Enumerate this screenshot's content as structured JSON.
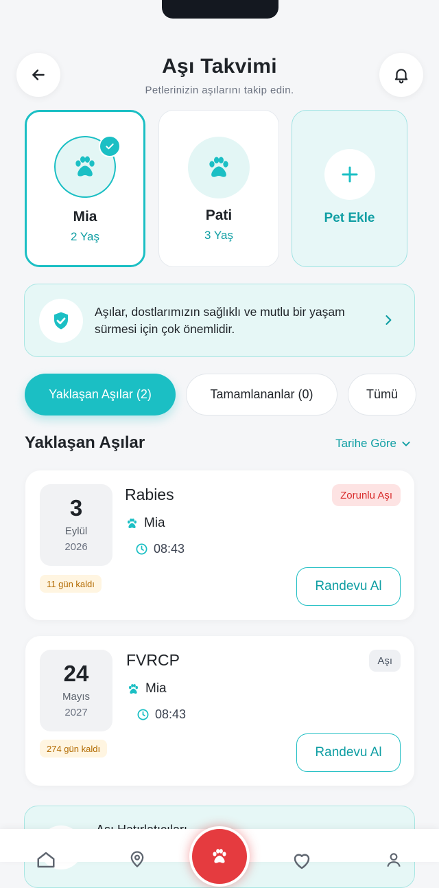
{
  "header": {
    "title": "Aşı Takvimi",
    "subtitle": "Petlerinizin aşılarını takip edin."
  },
  "pets": [
    {
      "name": "Mia",
      "age": "2 Yaş",
      "selected": true
    },
    {
      "name": "Pati",
      "age": "3 Yaş",
      "selected": false
    }
  ],
  "add_pet": {
    "label": "Pet Ekle"
  },
  "info_banner": {
    "text": "Aşılar, dostlarımızın sağlıklı ve mutlu bir yaşam sürmesi için çok önemlidir."
  },
  "tabs": [
    {
      "label": "Yaklaşan Aşılar (2)",
      "active": true
    },
    {
      "label": "Tamamlananlar (0)",
      "active": false
    },
    {
      "label": "Tümü",
      "active": false
    }
  ],
  "section": {
    "title": "Yaklaşan Aşılar",
    "sort_label": "Tarihe Göre"
  },
  "vaccines": [
    {
      "day": "3",
      "month": "Eylül",
      "year": "2026",
      "days_left": "11 gün kaldı",
      "name": "Rabies",
      "pet": "Mia",
      "time": "08:43",
      "badge": "Zorunlu Aşı",
      "badge_type": "required",
      "button": "Randevu Al"
    },
    {
      "day": "24",
      "month": "Mayıs",
      "year": "2027",
      "days_left": "274 gün kaldı",
      "name": "FVRCP",
      "pet": "Mia",
      "time": "08:43",
      "badge": "Aşı",
      "badge_type": "normal",
      "button": "Randevu Al"
    }
  ],
  "reminder": {
    "title": "Aşı Hatırlatıcıları"
  },
  "colors": {
    "accent": "#1bbfc4",
    "accent_dark": "#0f9ea3",
    "danger": "#e53b3f",
    "background": "#f5f6f8"
  }
}
